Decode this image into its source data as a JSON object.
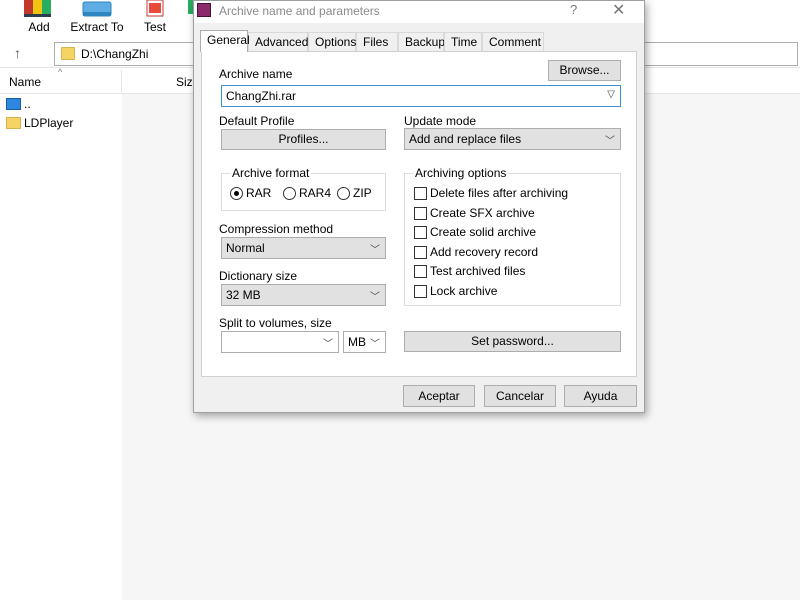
{
  "toolbar": {
    "add_label": "Add",
    "extract_label": "Extract To",
    "test_label": "Test"
  },
  "address": {
    "path": "D:\\ChangZhi"
  },
  "columns": {
    "name": "Name",
    "size": "Size"
  },
  "files": [
    {
      "name": ".."
    },
    {
      "name": "LDPlayer"
    }
  ],
  "dialog": {
    "title": "Archive name and parameters",
    "help": "?",
    "close": "✕",
    "tabs": [
      "General",
      "Advanced",
      "Options",
      "Files",
      "Backup",
      "Time",
      "Comment"
    ],
    "archive_name_label": "Archive name",
    "browse_label": "Browse...",
    "archive_name_value": "ChangZhi.rar",
    "default_profile_label": "Default Profile",
    "profiles_label": "Profiles...",
    "update_mode_label": "Update mode",
    "update_mode_value": "Add and replace files",
    "archive_format_label": "Archive format",
    "formats": {
      "rar": "RAR",
      "rar4": "RAR4",
      "zip": "ZIP",
      "selected": "RAR"
    },
    "archiving_options_label": "Archiving options",
    "options": [
      "Delete files after archiving",
      "Create SFX archive",
      "Create solid archive",
      "Add recovery record",
      "Test archived files",
      "Lock archive"
    ],
    "compression_method_label": "Compression method",
    "compression_method_value": "Normal",
    "dictionary_size_label": "Dictionary size",
    "dictionary_size_value": "32 MB",
    "split_label": "Split to volumes, size",
    "split_value": "",
    "split_unit": "MB",
    "set_password_label": "Set password...",
    "ok_label": "Aceptar",
    "cancel_label": "Cancelar",
    "help_label": "Ayuda"
  }
}
